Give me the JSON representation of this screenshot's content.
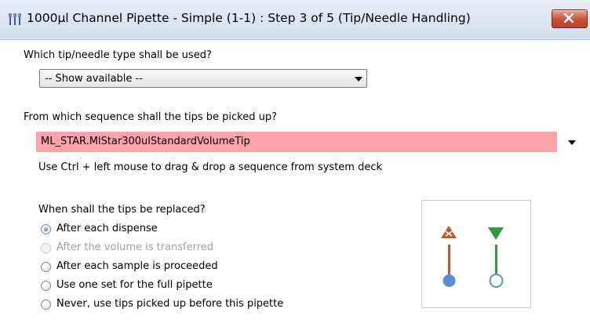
{
  "window": {
    "title": "1000µl Channel Pipette - Simple (1-1) : Step 3 of 5 (Tip/Needle Handling)"
  },
  "tip_type": {
    "question": "Which tip/needle type shall be used?",
    "selected": "-- Show available --"
  },
  "sequence": {
    "question": "From which sequence shall the tips be picked up?",
    "value": "ML_STAR.MlStar300ulStandardVolumeTip",
    "hint": "Use Ctrl + left mouse to drag & drop a sequence from system deck",
    "field_color": "#ffa3aa"
  },
  "replace": {
    "question": "When shall the tips be replaced?",
    "options": [
      {
        "label": "After each dispense",
        "checked": true,
        "enabled": true
      },
      {
        "label": "After the volume is transferred",
        "checked": false,
        "enabled": false
      },
      {
        "label": "After each sample is proceeded",
        "checked": false,
        "enabled": true
      },
      {
        "label": "Use one set for the full pipette",
        "checked": false,
        "enabled": true
      },
      {
        "label": "Never, use tips picked up before this pipette",
        "checked": false,
        "enabled": true
      }
    ]
  },
  "icons": {
    "app": "pipette-channel-icon",
    "close": "close-icon",
    "illustration": [
      "tip-eject-icon",
      "tip-pickup-icon"
    ]
  },
  "colors": {
    "titlebar": "#dbe4f1",
    "close_button": "#c8513b"
  }
}
